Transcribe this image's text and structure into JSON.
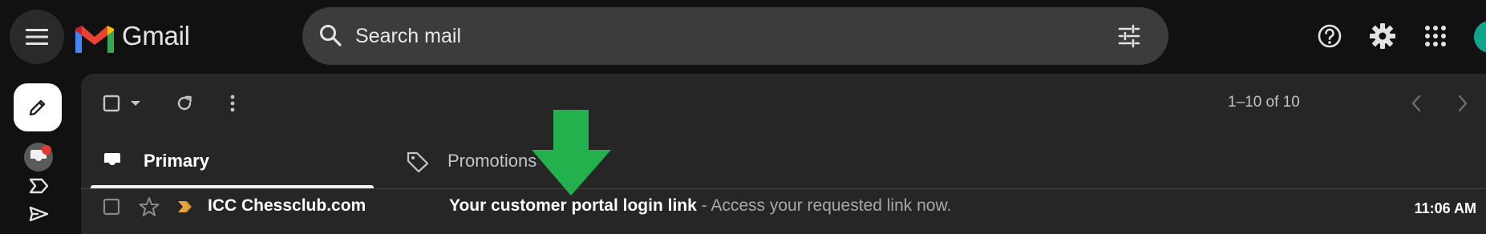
{
  "app": {
    "name": "Gmail"
  },
  "search": {
    "placeholder": "Search mail"
  },
  "toolbar": {
    "pagination": "1–10 of 10"
  },
  "tabs": [
    {
      "label": "Primary",
      "active": true
    },
    {
      "label": "Promotions",
      "active": false
    }
  ],
  "emails": [
    {
      "sender": "ICC Chessclub.com",
      "subject": "Your customer portal login link",
      "snippet": " - Access your requested link now.",
      "time": "11:06 AM",
      "starred": false,
      "important": true
    }
  ],
  "colors": {
    "background": "#111111",
    "panel": "#262626",
    "search_bg": "#3c3c3c",
    "annotation_arrow": "#22b14c",
    "important_marker": "#e8a33d",
    "notification_badge": "#e53935"
  },
  "icons": [
    "menu-icon",
    "gmail-logo-icon",
    "search-icon",
    "tune-icon",
    "help-icon",
    "settings-icon",
    "apps-grid-icon",
    "compose-pencil-icon",
    "inbox-icon",
    "label-icon",
    "send-icon",
    "checkbox-icon",
    "dropdown-caret-icon",
    "refresh-icon",
    "more-vert-icon",
    "chevron-left-icon",
    "chevron-right-icon",
    "tag-icon",
    "star-icon",
    "important-marker-icon",
    "green-down-arrow-icon"
  ]
}
